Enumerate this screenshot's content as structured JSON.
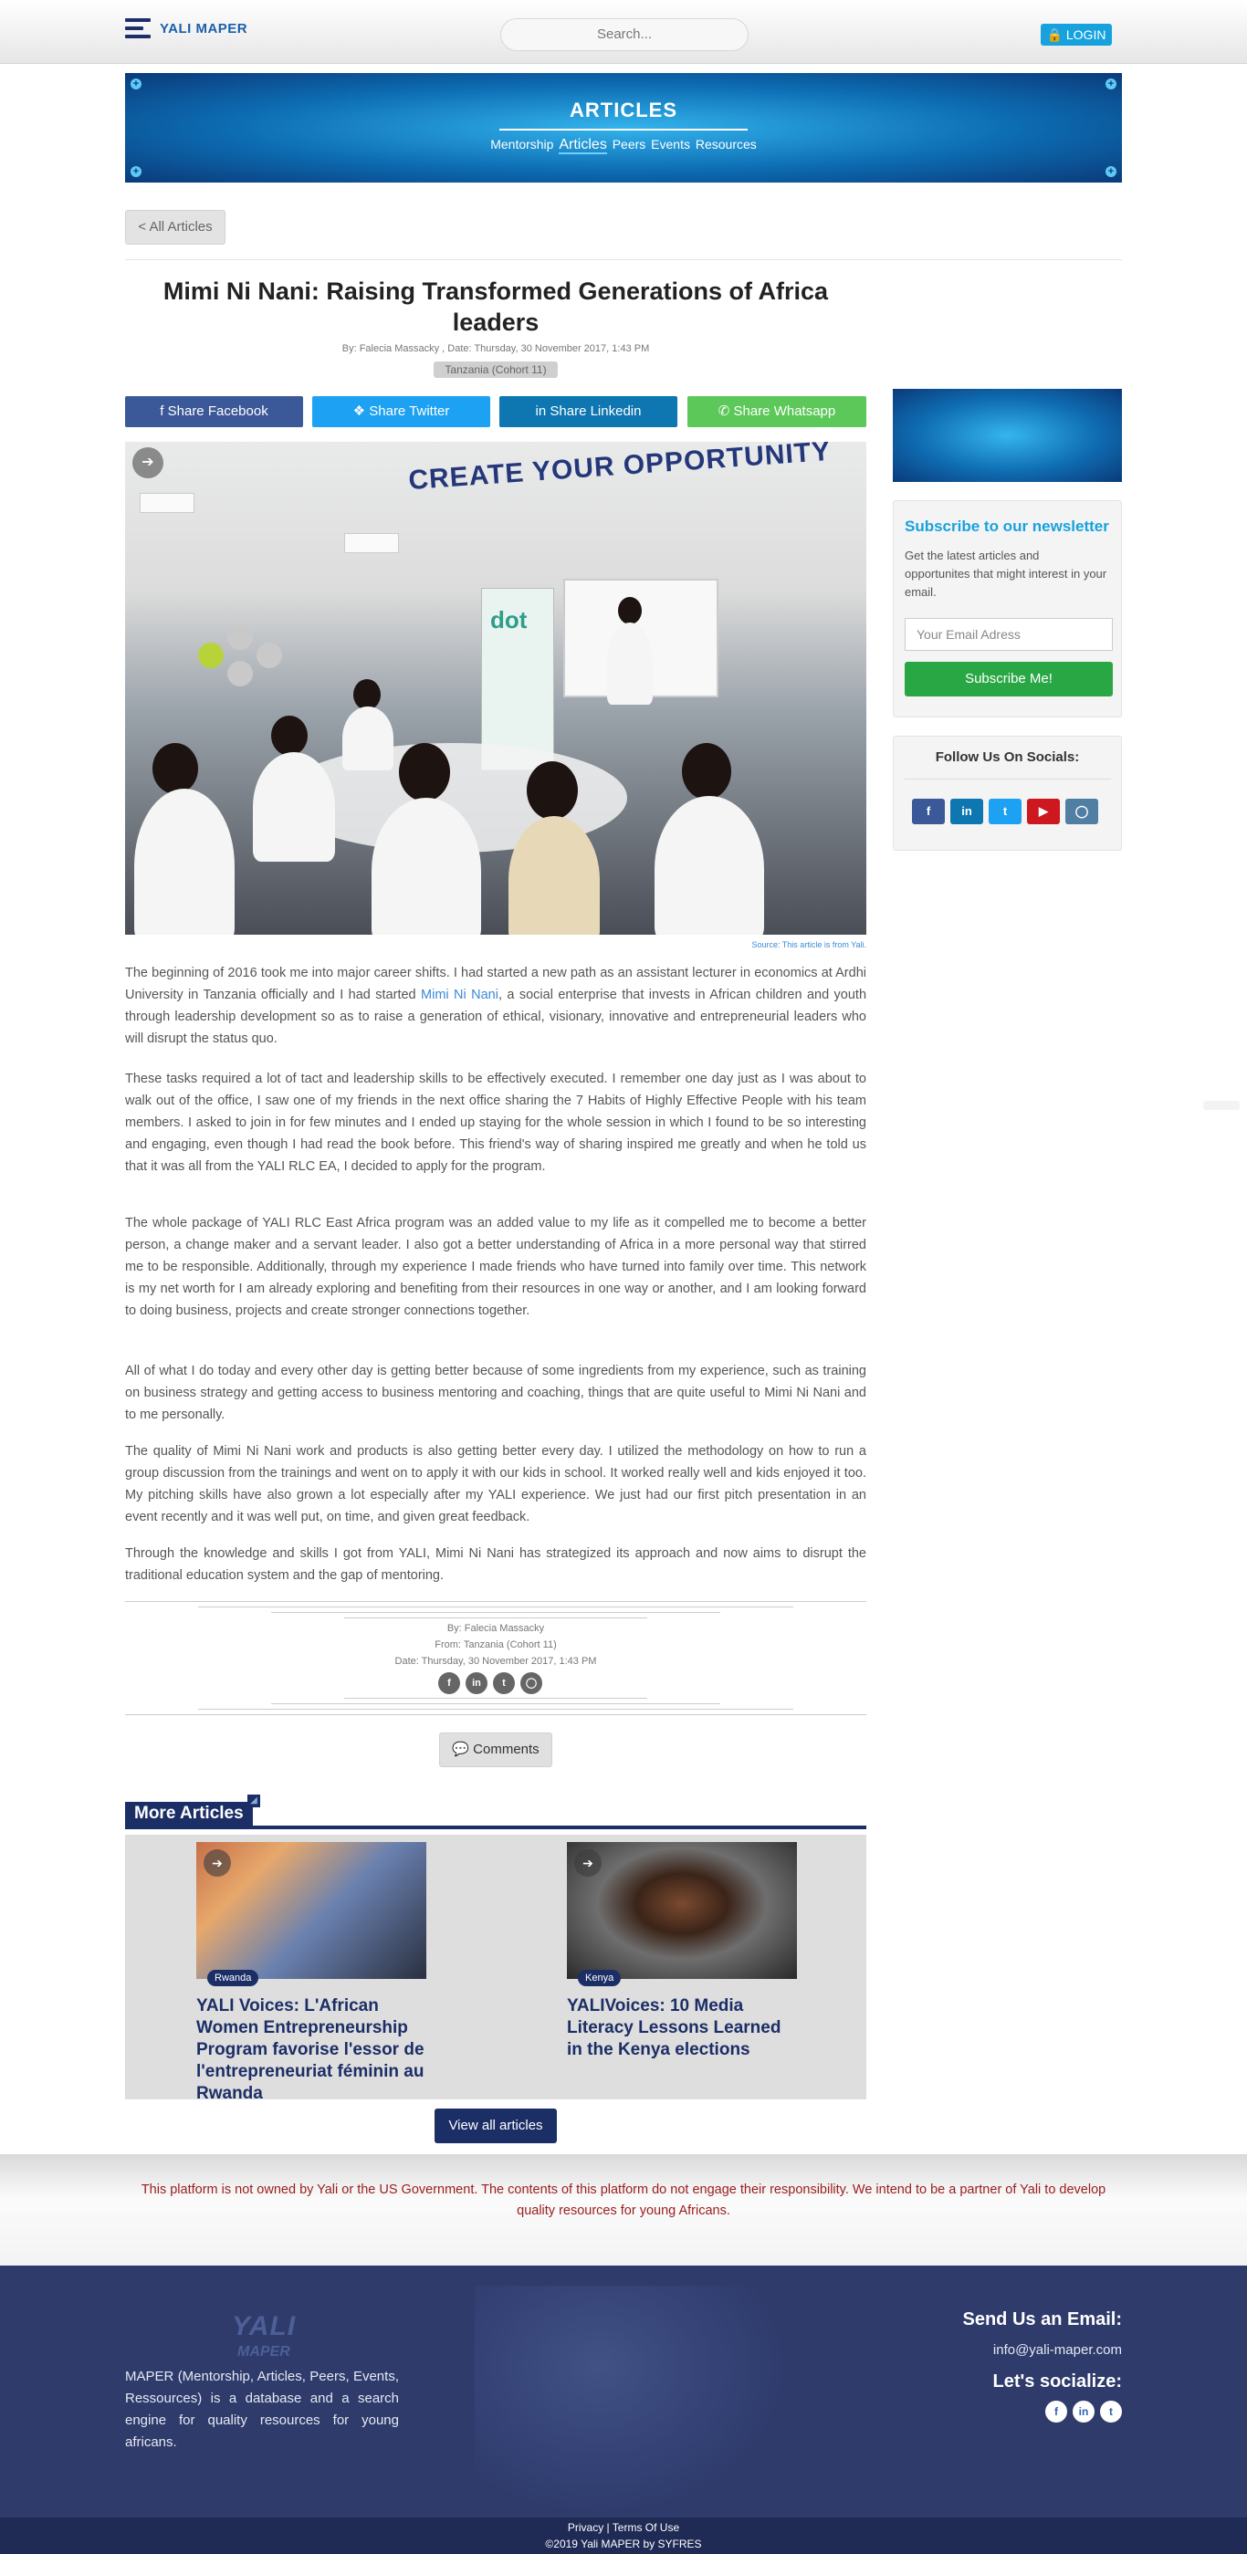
{
  "navbar": {
    "brand": "YALI MAPER",
    "search_placeholder": "Search...",
    "login": "LOGIN"
  },
  "banner": {
    "title": "ARTICLES",
    "nav": [
      "Mentorship",
      "Articles",
      "Peers",
      "Events",
      "Resources"
    ],
    "active": "Articles"
  },
  "back_button": "< All Articles",
  "article": {
    "title": "Mimi Ni Nani: Raising Transformed Generations of Africa leaders",
    "byline": "By: Falecia Massacky , Date: Thursday, 30 November 2017, 1:43 PM",
    "country": "Tanzania (Cohort 11)",
    "share": {
      "facebook": "Share Facebook",
      "twitter": "Share Twitter",
      "linkedin": "Share Linkedin",
      "whatsapp": "Share Whatsapp"
    },
    "image_text": "CREATE YOUR OPPORTUNITY",
    "image_logo": "dot",
    "source": "Source: This article is from Yali.",
    "p1_before": "The beginning of 2016 took me into major career shifts. I had started a new path as an assistant lecturer in economics at Ardhi University in Tanzania officially and I had started ",
    "p1_link": "Mimi Ni Nani",
    "p1_after": ", a social enterprise that invests in African children and youth through leadership development so as to raise a generation of ethical, visionary, innovative and entrepreneurial leaders who will disrupt the status quo.",
    "p2": "These tasks required a lot of tact and leadership skills to be effectively executed. I remember one day just as I was about to walk out of the office, I saw one of my friends in the next office sharing the 7 Habits of Highly Effective People with his team members. I asked to join in for few minutes and I ended up staying for the whole session in which I found to be so interesting and engaging, even though I had read the book before. This friend's way of sharing inspired me greatly and when he told us that it was all from the YALI RLC EA, I decided to apply for the program.",
    "p3": "The whole package of YALI RLC East Africa program was an added value to my life as it compelled me to become a better person, a change maker and a servant leader. I also got a better understanding of Africa in a more personal way that stirred me to be responsible. Additionally, through my experience I made friends who have turned into family over time. This network is my net worth for I am already exploring and benefiting from their resources in one way or another, and I am looking forward to doing business, projects and create stronger connections together.",
    "p4": "All of what I do today and every other day is getting better because of some ingredients from my experience, such as training on business strategy and getting access to business mentoring and coaching, things that are quite useful to Mimi Ni Nani and to me personally.",
    "p5": "The quality of Mimi Ni Nani work and products is also getting better every day. I utilized the methodology on how to run a group discussion from the trainings and went on to apply it with our kids in school. It worked really well and kids enjoyed it too. My pitching skills have also grown a lot especially after my YALI experience. We just had our first pitch presentation in an event recently and it was well put, on time, and given great feedback.",
    "p6": "Through the knowledge and skills I got from YALI, Mimi Ni Nani has strategized its approach and now aims to disrupt the traditional education system and the gap of mentoring."
  },
  "author_box": {
    "by": "By: Falecia Massacky",
    "from": "From: Tanzania (Cohort 11)",
    "date": "Date: Thursday, 30 November 2017, 1:43 PM"
  },
  "comments_button": "Comments",
  "more_articles": {
    "heading": "More Articles",
    "cards": [
      {
        "country": "Rwanda",
        "title": "YALI Voices: L'African Women Entrepreneurship Program favorise l'essor de l'entrepreneuriat féminin au Rwanda"
      },
      {
        "country": "Kenya",
        "title": "YALIVoices: 10 Media Literacy Lessons Learned in the Kenya elections"
      }
    ],
    "view_all": "View all articles"
  },
  "sidebar": {
    "newsletter_title": "Subscribe to our newsletter",
    "newsletter_desc": "Get the latest articles and opportunites that might interest in your email.",
    "email_placeholder": "Your Email Adress",
    "subscribe": "Subscribe Me!",
    "follow_title": "Follow Us On Socials:"
  },
  "disclaimer": "This platform is not owned by Yali or the US Government. The contents of this platform do not engage their responsibility. We intend to be a partner of Yali to develop quality resources for young Africans.",
  "footer": {
    "logo": "YALI",
    "logo_sub": "MAPER",
    "about": "MAPER (Mentorship, Articles, Peers, Events, Ressources) is a database and a search engine for quality resources for young africans.",
    "send_title": "Send Us an Email:",
    "email": "info@yali-maper.com",
    "social_title": "Let's socialize:",
    "links": "Privacy | Terms Of Use",
    "copyright": "©2019 Yali MAPER by SYFRES"
  },
  "colors": {
    "navy": "#1c2e66",
    "accent_blue": "#17a2de",
    "subscribe_green": "#29a744",
    "disclaimer_red": "#9a1d1d",
    "footer_bg": "#2e3b6b"
  }
}
